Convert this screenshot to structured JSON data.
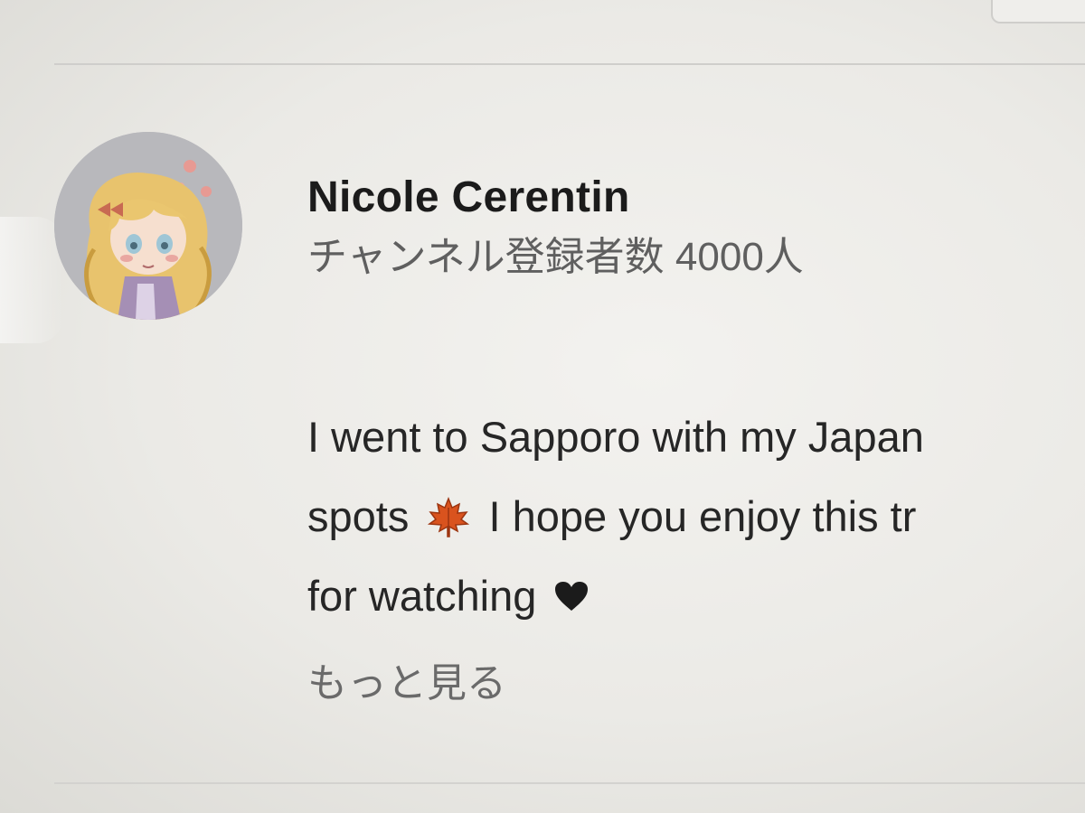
{
  "channel": {
    "name": "Nicole Cerentin",
    "subscribers": "チャンネル登録者数 4000人"
  },
  "description": {
    "line1": "I went to Sapporo with my Japan",
    "line2_before_icon": "spots",
    "line2_icon": "maple-leaf-icon",
    "line2_after_icon": "I hope you enjoy this tr",
    "line3": "for watching",
    "line3_icon": "heart-icon"
  },
  "show_more_label": "もっと見る",
  "colors": {
    "background": "#ebeae6",
    "primary_text": "#1b1b1b",
    "secondary_text": "#5f5f5f",
    "maple_leaf": "#d9531e",
    "heart": "#1b1b1b"
  }
}
